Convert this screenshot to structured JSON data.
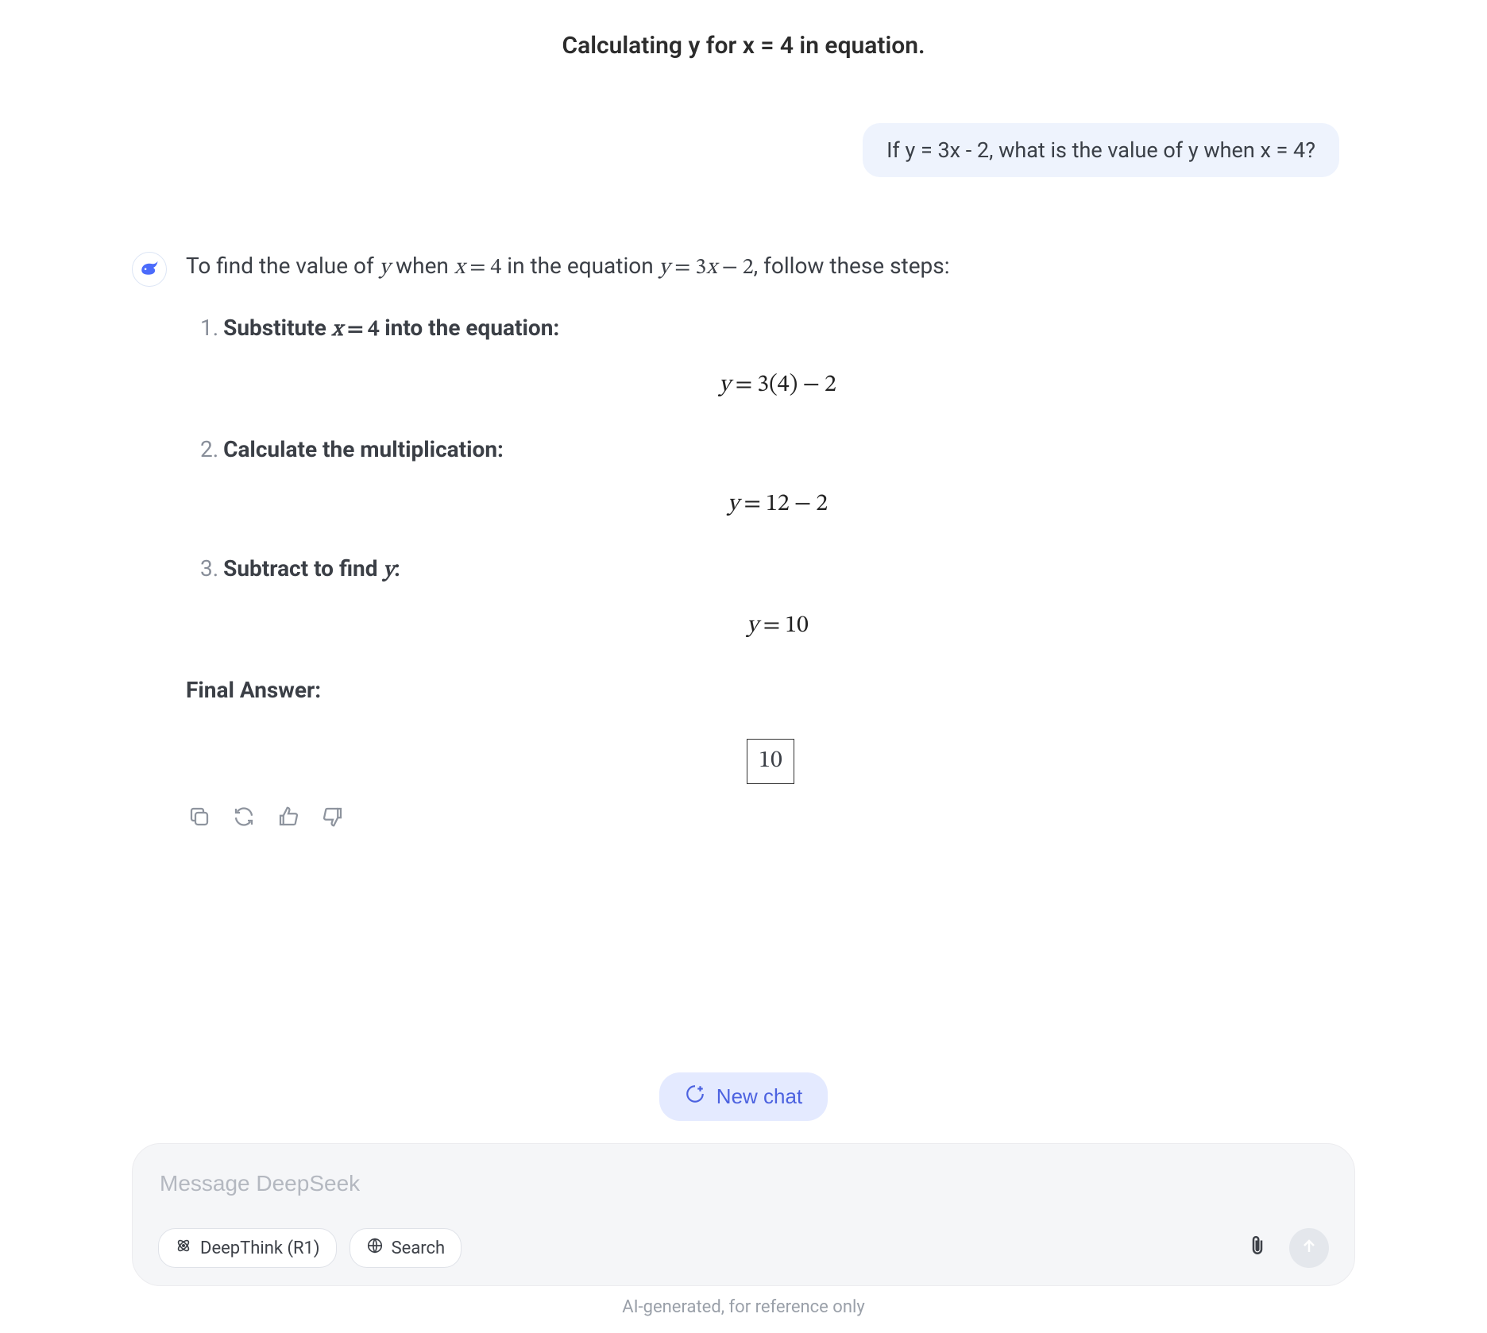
{
  "title": "Calculating y for x = 4 in equation.",
  "user_message": "If y = 3x - 2, what is the value of y when x = 4?",
  "assistant": {
    "intro_prefix": "To find the value of ",
    "intro_var_y": "y",
    "intro_mid1": " when ",
    "intro_eq_x": "x = 4",
    "intro_mid2": " in the equation ",
    "intro_eq_main": "y = 3x − 2",
    "intro_suffix": ", follow these steps:",
    "steps": [
      {
        "num": "1.",
        "head_prefix": "Substitute ",
        "head_math": "x = 4",
        "head_suffix": " into the equation:",
        "equation": "y = 3(4) − 2"
      },
      {
        "num": "2.",
        "head_prefix": "Calculate the multiplication:",
        "head_math": "",
        "head_suffix": "",
        "equation": "y = 12 − 2"
      },
      {
        "num": "3.",
        "head_prefix": "Subtract to find ",
        "head_math": "y",
        "head_suffix": ":",
        "equation": "y = 10"
      }
    ],
    "final_label": "Final Answer:",
    "final_value": "10"
  },
  "new_chat_label": "New chat",
  "input_placeholder": "Message DeepSeek",
  "chips": {
    "deepthink": "DeepThink (R1)",
    "search": "Search"
  },
  "disclaimer": "AI-generated, for reference only"
}
